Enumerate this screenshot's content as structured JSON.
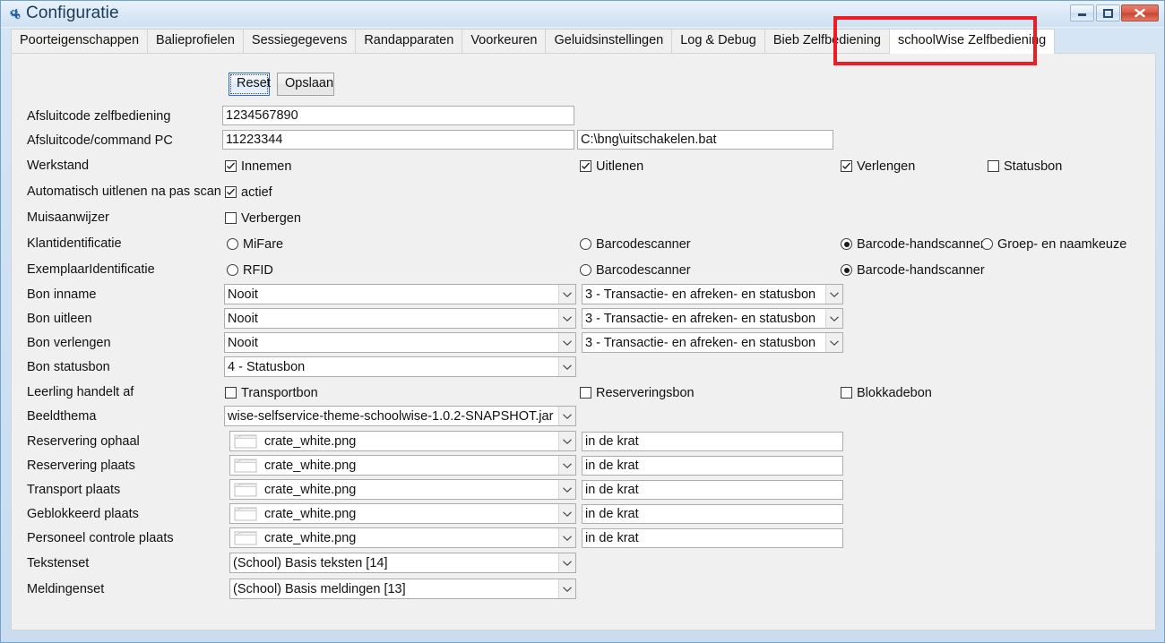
{
  "window": {
    "title": "Configuratie",
    "icon": "gears-icon",
    "controls": {
      "minimize": "minimize-icon",
      "maximize": "maximize-icon",
      "close": "close-icon"
    }
  },
  "tabs": [
    {
      "label": "Poorteigenschappen",
      "active": false
    },
    {
      "label": "Balieprofielen",
      "active": false
    },
    {
      "label": "Sessiegegevens",
      "active": false
    },
    {
      "label": "Randapparaten",
      "active": false
    },
    {
      "label": "Voorkeuren",
      "active": false
    },
    {
      "label": "Geluidsinstellingen",
      "active": false
    },
    {
      "label": "Log & Debug",
      "active": false
    },
    {
      "label": "Bieb Zelfbediening",
      "active": false
    },
    {
      "label": "schoolWise Zelfbediening",
      "active": true
    }
  ],
  "toolbar": {
    "reset_label": "Reset",
    "save_label": "Opslaan"
  },
  "form": {
    "afsluitcode_zelfbediening": {
      "label": "Afsluitcode zelfbediening",
      "value": "1234567890"
    },
    "afsluitcode_command_pc": {
      "label": "Afsluitcode/command PC",
      "value": "11223344",
      "command_value": "C:\\bng\\uitschakelen.bat"
    },
    "werkstand": {
      "label": "Werkstand",
      "options": [
        {
          "label": "Innemen",
          "checked": true
        },
        {
          "label": "Uitlenen",
          "checked": true
        },
        {
          "label": "Verlengen",
          "checked": true
        },
        {
          "label": "Statusbon",
          "checked": false
        }
      ]
    },
    "auto_uitlenen": {
      "label": "Automatisch uitlenen na pas scan",
      "option": {
        "label": "actief",
        "checked": true
      }
    },
    "muisaanwijzer": {
      "label": "Muisaanwijzer",
      "option": {
        "label": "Verbergen",
        "checked": false
      }
    },
    "klantidentificatie": {
      "label": "Klantidentificatie",
      "options": [
        {
          "label": "MiFare",
          "selected": false
        },
        {
          "label": "Barcodescanner",
          "selected": false
        },
        {
          "label": "Barcode-handscanner",
          "selected": true
        },
        {
          "label": "Groep- en naamkeuze",
          "selected": false
        }
      ]
    },
    "exemplaaridentificatie": {
      "label": "ExemplaarIdentificatie",
      "options": [
        {
          "label": "RFID",
          "selected": false
        },
        {
          "label": "Barcodescanner",
          "selected": false
        },
        {
          "label": "Barcode-handscanner",
          "selected": true
        }
      ]
    },
    "bon_inname": {
      "label": "Bon inname",
      "value": "Nooit",
      "value2": "3 - Transactie- en afreken- en statusbon"
    },
    "bon_uitleen": {
      "label": "Bon uitleen",
      "value": "Nooit",
      "value2": "3 - Transactie- en afreken- en statusbon"
    },
    "bon_verlengen": {
      "label": "Bon verlengen",
      "value": "Nooit",
      "value2": "3 - Transactie- en afreken- en statusbon"
    },
    "bon_statusbon": {
      "label": "Bon statusbon",
      "value": "4 - Statusbon"
    },
    "leerling_handelt_af": {
      "label": "Leerling handelt af",
      "options": [
        {
          "label": "Transportbon",
          "checked": false
        },
        {
          "label": "Reserveringsbon",
          "checked": false
        },
        {
          "label": "Blokkadebon",
          "checked": false
        }
      ]
    },
    "beeldthema": {
      "label": "Beeldthema",
      "value": "wise-selfservice-theme-schoolwise-1.0.2-SNAPSHOT.jar"
    },
    "image_rows": [
      {
        "label": "Reservering ophaal",
        "image": "crate_white.png",
        "text": "in de krat"
      },
      {
        "label": "Reservering plaats",
        "image": "crate_white.png",
        "text": "in de krat"
      },
      {
        "label": "Transport plaats",
        "image": "crate_white.png",
        "text": "in de krat"
      },
      {
        "label": "Geblokkeerd plaats",
        "image": "crate_white.png",
        "text": "in de krat"
      },
      {
        "label": "Personeel controle plaats",
        "image": "crate_white.png",
        "text": "in de krat"
      }
    ],
    "tekstenset": {
      "label": "Tekstenset",
      "value": "(School) Basis teksten [14]"
    },
    "meldingenset": {
      "label": "Meldingenset",
      "value": "(School) Basis meldingen [13]"
    }
  },
  "annotation": {
    "color": "#ee1c25",
    "target": "schoolWise Zelfbediening"
  }
}
